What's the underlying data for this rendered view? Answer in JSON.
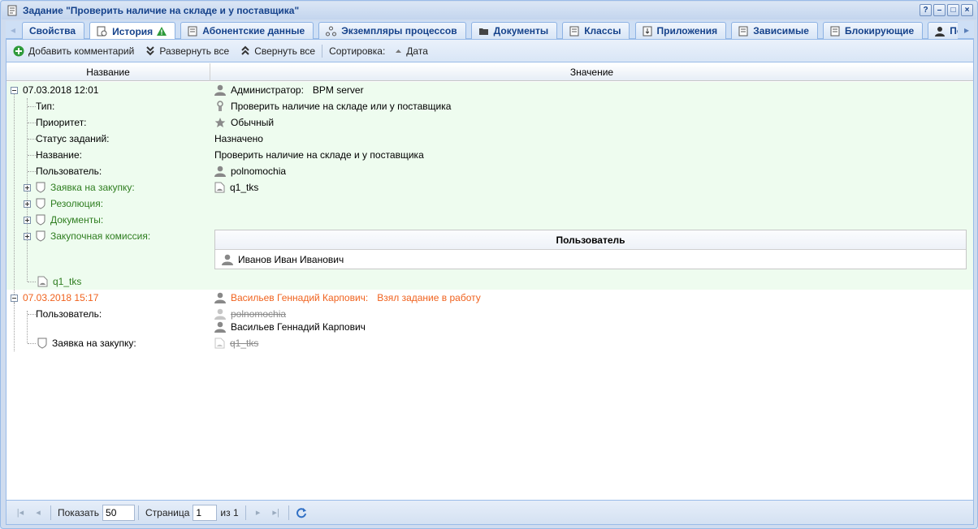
{
  "window": {
    "title": "Задание \"Проверить наличие на складе и у поставщика\"",
    "tools": [
      "?",
      "–",
      "□",
      "×"
    ]
  },
  "tabs": [
    {
      "label": "Свойства",
      "icon": "none"
    },
    {
      "label": "История",
      "icon": "history-icon",
      "active": true,
      "badge": "warning-icon"
    },
    {
      "label": "Абонентские данные",
      "icon": "document-icon"
    },
    {
      "label": "Экземпляры процессов",
      "icon": "process-icon"
    },
    {
      "label": "Документы",
      "icon": "folder-icon"
    },
    {
      "label": "Классы",
      "icon": "document-icon"
    },
    {
      "label": "Приложения",
      "icon": "attachment-icon"
    },
    {
      "label": "Зависимые",
      "icon": "document-icon"
    },
    {
      "label": "Блокирующие",
      "icon": "document-icon"
    },
    {
      "label": "Подписчики",
      "icon": "user-icon"
    }
  ],
  "toolbar": {
    "add_comment": "Добавить комментарий",
    "expand_all": "Развернуть все",
    "collapse_all": "Свернуть все",
    "sort_label": "Сортировка:",
    "sort_field": "Дата"
  },
  "columns": {
    "name": "Название",
    "value": "Значение"
  },
  "history": {
    "entry1": {
      "date": "07.03.2018 12:01",
      "author_label": "Администратор:",
      "author": "BPM server",
      "type_label": "Тип:",
      "type_value": "Проверить наличие на складе или у поставщика",
      "priority_label": "Приоритет:",
      "priority_value": "Обычный",
      "status_label": "Статус заданий:",
      "status_value": "Назначено",
      "name_label": "Название:",
      "name_value": "Проверить наличие на складе и у поставщика",
      "user_label": "Пользователь:",
      "user_value": "polnomochia",
      "request_label": "Заявка на закупку:",
      "request_value": "q1_tks",
      "resolution_label": "Резолюция:",
      "documents_label": "Документы:",
      "commission_label": "Закупочная комиссия:",
      "subgrid_header": "Пользователь",
      "subgrid_user": "Иванов Иван Иванович",
      "file": "q1_tks"
    },
    "entry2": {
      "date": "07.03.2018 15:17",
      "author": "Васильев Геннадий Карпович:",
      "action": "Взял задание в работу",
      "user_label": "Пользователь:",
      "old_user": "polnomochia",
      "new_user": "Васильев Геннадий Карпович",
      "request_label": "Заявка на закупку:",
      "request_old": "q1_tks"
    }
  },
  "pager": {
    "show_label": "Показать",
    "page_size": "50",
    "page_label": "Страница",
    "page": "1",
    "of_label": "из 1"
  }
}
